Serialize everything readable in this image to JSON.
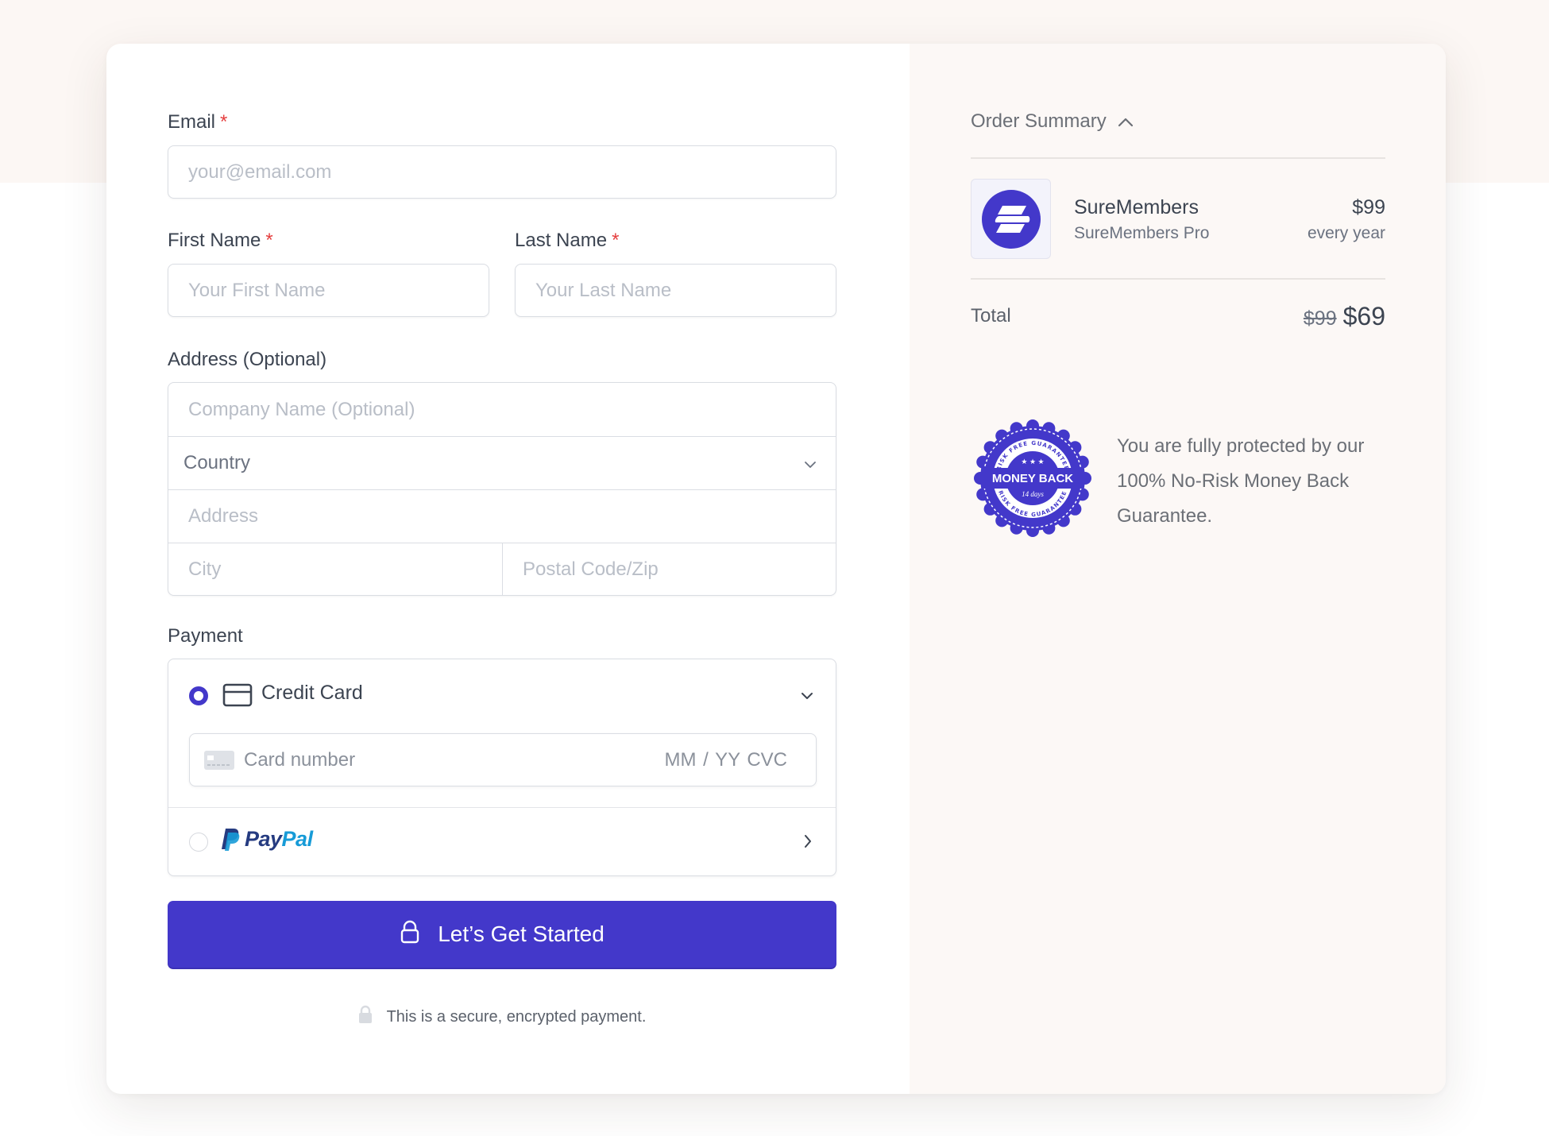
{
  "form": {
    "email": {
      "label": "Email",
      "required_mark": "*",
      "placeholder": "your@email.com",
      "value": ""
    },
    "first_name": {
      "label": "First Name",
      "required_mark": "*",
      "placeholder": "Your First Name",
      "value": ""
    },
    "last_name": {
      "label": "Last Name",
      "required_mark": "*",
      "placeholder": "Your Last Name",
      "value": ""
    },
    "address": {
      "label": "Address (Optional)",
      "company_placeholder": "Company Name (Optional)",
      "country_selected": "Country",
      "address_placeholder": "Address",
      "city_placeholder": "City",
      "postal_placeholder": "Postal Code/Zip"
    },
    "payment": {
      "label": "Payment",
      "methods": [
        {
          "name": "Credit Card",
          "selected": true,
          "icon": "credit-card-icon"
        },
        {
          "name": "PayPal",
          "selected": false,
          "icon": "paypal-logo"
        }
      ],
      "card_number_placeholder": "Card number",
      "card_expiry_cvc_placeholder": "MM / YY  CVC",
      "paypal_text_1": "Pay",
      "paypal_text_2": "Pal"
    },
    "submit_label": "Let’s Get Started",
    "secure_note": "This is a secure, encrypted payment."
  },
  "summary": {
    "title": "Order Summary",
    "expanded": true,
    "items": [
      {
        "name": "SureMembers",
        "variant": "SureMembers Pro",
        "price": "$99",
        "period": "every year"
      }
    ],
    "total_label": "Total",
    "total_original": "$99",
    "total_price": "$69",
    "badge": {
      "top_text": "RISK FREE GUARANTEE",
      "main_text": "MONEY BACK",
      "sub_text": "14 days",
      "bottom_text": "RISK FREE GUARANTEE"
    },
    "guarantee_text": "You are fully protected by our 100% No-Risk Money Back Guarantee."
  },
  "colors": {
    "accent": "#4338ca",
    "required": "#e53e3e",
    "summary_bg": "#fcf8f6",
    "paypal_dark": "#253b80",
    "paypal_light": "#179bd7"
  }
}
